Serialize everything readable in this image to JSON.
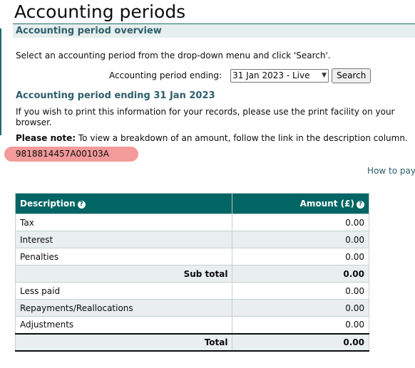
{
  "page": {
    "title": "Accounting periods",
    "section_title": "Accounting period overview",
    "intro": "Select an accounting period from the drop-down menu and click 'Search'."
  },
  "period_select": {
    "label": "Accounting period ending:",
    "selected": "31 Jan 2023 - Live",
    "search_label": "Search"
  },
  "period_details": {
    "heading": "Accounting period ending 31 Jan 2023",
    "print_text": "If you wish to print this information for your records, please use the print facility on your browser.",
    "note_label": "Please note:",
    "note_text": " To view a breakdown of an amount, follow the link in the description column.",
    "reference": "9818814457A00103A",
    "how_to_pay_link": "How to pay"
  },
  "table": {
    "headers": {
      "description": "Description",
      "amount": "Amount (£)"
    },
    "rows": [
      {
        "description": "Tax",
        "amount": "0.00"
      },
      {
        "description": "Interest",
        "amount": "0.00"
      },
      {
        "description": "Penalties",
        "amount": "0.00"
      },
      {
        "description": "Sub total",
        "amount": "0.00"
      },
      {
        "description": "Less paid",
        "amount": "0.00"
      },
      {
        "description": "Repayments/Reallocations",
        "amount": "0.00"
      },
      {
        "description": "Adjustments",
        "amount": "0.00"
      },
      {
        "description": "Total",
        "amount": "0.00"
      }
    ]
  },
  "icons": {
    "help": "help-icon",
    "select_chevron": "chevron-down-icon"
  },
  "colors": {
    "header_bg": "#006563",
    "heading_text": "#2e5f6b",
    "section_bar_bg": "#e6eeee",
    "highlight": "#f39a9a",
    "alt_row_bg": "#e9eeee"
  }
}
